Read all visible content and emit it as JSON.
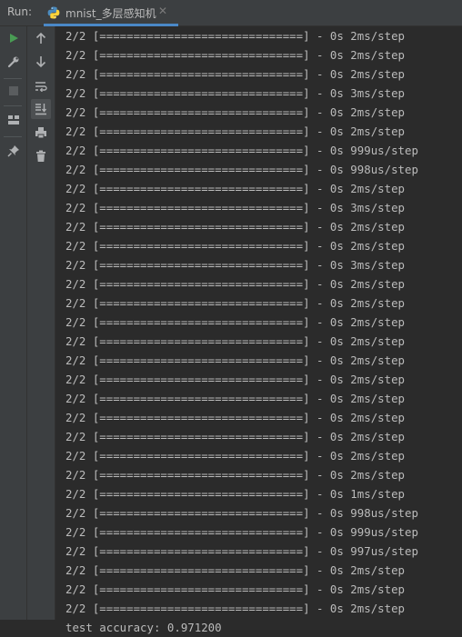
{
  "header": {
    "run_label": "Run:",
    "tab_title": "mnist_多层感知机"
  },
  "console": {
    "lines": [
      "2/2 [==============================] - 0s 2ms/step",
      "2/2 [==============================] - 0s 2ms/step",
      "2/2 [==============================] - 0s 2ms/step",
      "2/2 [==============================] - 0s 3ms/step",
      "2/2 [==============================] - 0s 2ms/step",
      "2/2 [==============================] - 0s 2ms/step",
      "2/2 [==============================] - 0s 999us/step",
      "2/2 [==============================] - 0s 998us/step",
      "2/2 [==============================] - 0s 2ms/step",
      "2/2 [==============================] - 0s 3ms/step",
      "2/2 [==============================] - 0s 2ms/step",
      "2/2 [==============================] - 0s 2ms/step",
      "2/2 [==============================] - 0s 3ms/step",
      "2/2 [==============================] - 0s 2ms/step",
      "2/2 [==============================] - 0s 2ms/step",
      "2/2 [==============================] - 0s 2ms/step",
      "2/2 [==============================] - 0s 2ms/step",
      "2/2 [==============================] - 0s 2ms/step",
      "2/2 [==============================] - 0s 2ms/step",
      "2/2 [==============================] - 0s 2ms/step",
      "2/2 [==============================] - 0s 2ms/step",
      "2/2 [==============================] - 0s 2ms/step",
      "2/2 [==============================] - 0s 2ms/step",
      "2/2 [==============================] - 0s 2ms/step",
      "2/2 [==============================] - 0s 1ms/step",
      "2/2 [==============================] - 0s 998us/step",
      "2/2 [==============================] - 0s 999us/step",
      "2/2 [==============================] - 0s 997us/step",
      "2/2 [==============================] - 0s 2ms/step",
      "2/2 [==============================] - 0s 2ms/step",
      "2/2 [==============================] - 0s 2ms/step"
    ],
    "final_line": "test accuracy: 0.971200"
  },
  "colors": {
    "accent": "#4a88c7",
    "run_green": "#499c54",
    "text": "#bbbbbb"
  }
}
